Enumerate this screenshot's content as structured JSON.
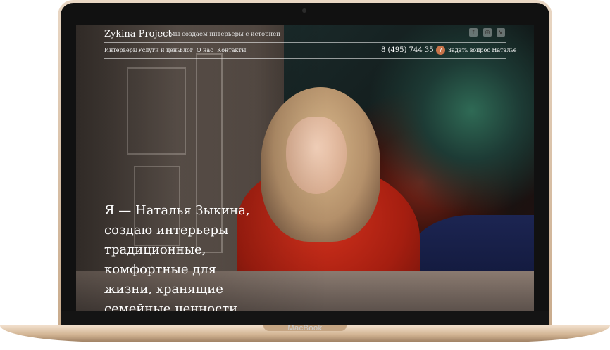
{
  "header": {
    "logo": "Zykina Project",
    "tagline": "Мы создаем интерьеры с историей"
  },
  "social": [
    {
      "name": "facebook",
      "glyph": "f"
    },
    {
      "name": "instagram",
      "glyph": "◎"
    },
    {
      "name": "vk",
      "glyph": "v"
    }
  ],
  "nav": {
    "items": [
      "Интерьеры",
      "Услуги и цены",
      "Блог",
      "О нас",
      "Контакты"
    ]
  },
  "contact": {
    "phone": "8 (495) 744 35 40",
    "badge": "?",
    "ask_label": "Задать вопрос Наталье"
  },
  "hero": {
    "lines": [
      "Я — Наталья Зыкина,",
      "создаю интерьеры",
      "традиционные,",
      "комфортные для",
      "жизни, хранящие",
      "семейные ценности."
    ]
  },
  "device": {
    "brand": "MacBook"
  },
  "colors": {
    "accent": "#c8744a",
    "frame": "#d2b493"
  }
}
